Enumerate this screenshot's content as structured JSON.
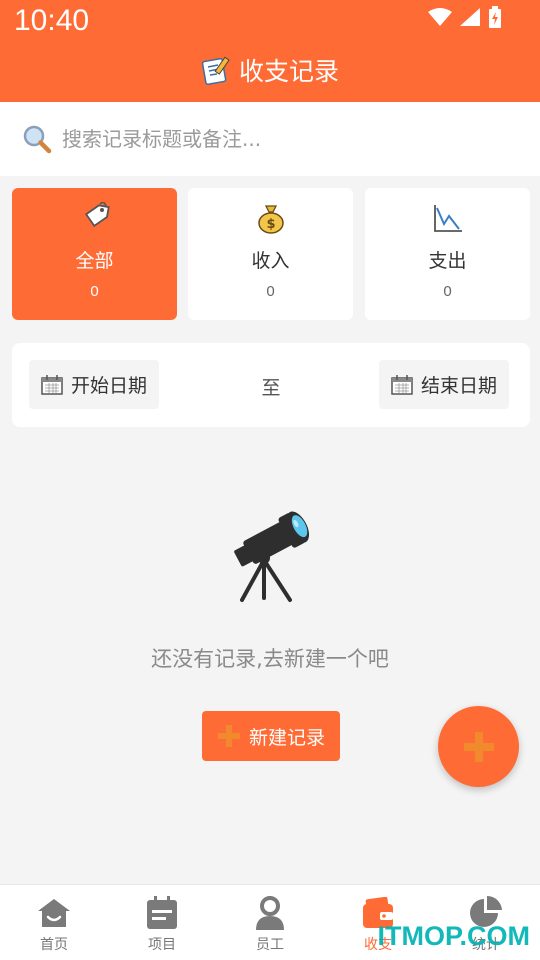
{
  "status_bar": {
    "time": "10:40"
  },
  "header": {
    "title": "收支记录",
    "title_icon": "notebook-pen-icon"
  },
  "search": {
    "placeholder": "搜索记录标题或备注..."
  },
  "filters": [
    {
      "label": "全部",
      "count": "0",
      "icon": "tag-icon",
      "active": true
    },
    {
      "label": "收入",
      "count": "0",
      "icon": "money-bag-icon",
      "active": false
    },
    {
      "label": "支出",
      "count": "0",
      "icon": "trend-down-icon",
      "active": false
    }
  ],
  "date_range": {
    "start_label": "开始日期",
    "separator": "至",
    "end_label": "结束日期"
  },
  "empty_state": {
    "message": "还没有记录,去新建一个吧",
    "button_label": "新建记录",
    "icon": "telescope-icon"
  },
  "bottom_nav": [
    {
      "label": "首页",
      "icon": "home-icon",
      "active": false
    },
    {
      "label": "项目",
      "icon": "clipboard-icon",
      "active": false
    },
    {
      "label": "员工",
      "icon": "person-icon",
      "active": false
    },
    {
      "label": "收支",
      "icon": "wallet-icon",
      "active": true
    },
    {
      "label": "统计",
      "icon": "pie-chart-icon",
      "active": false
    }
  ],
  "watermark": "ITMOP.COM",
  "colors": {
    "accent": "#ff6b35",
    "background": "#f4f4f4",
    "watermark": "#00b3b3"
  }
}
